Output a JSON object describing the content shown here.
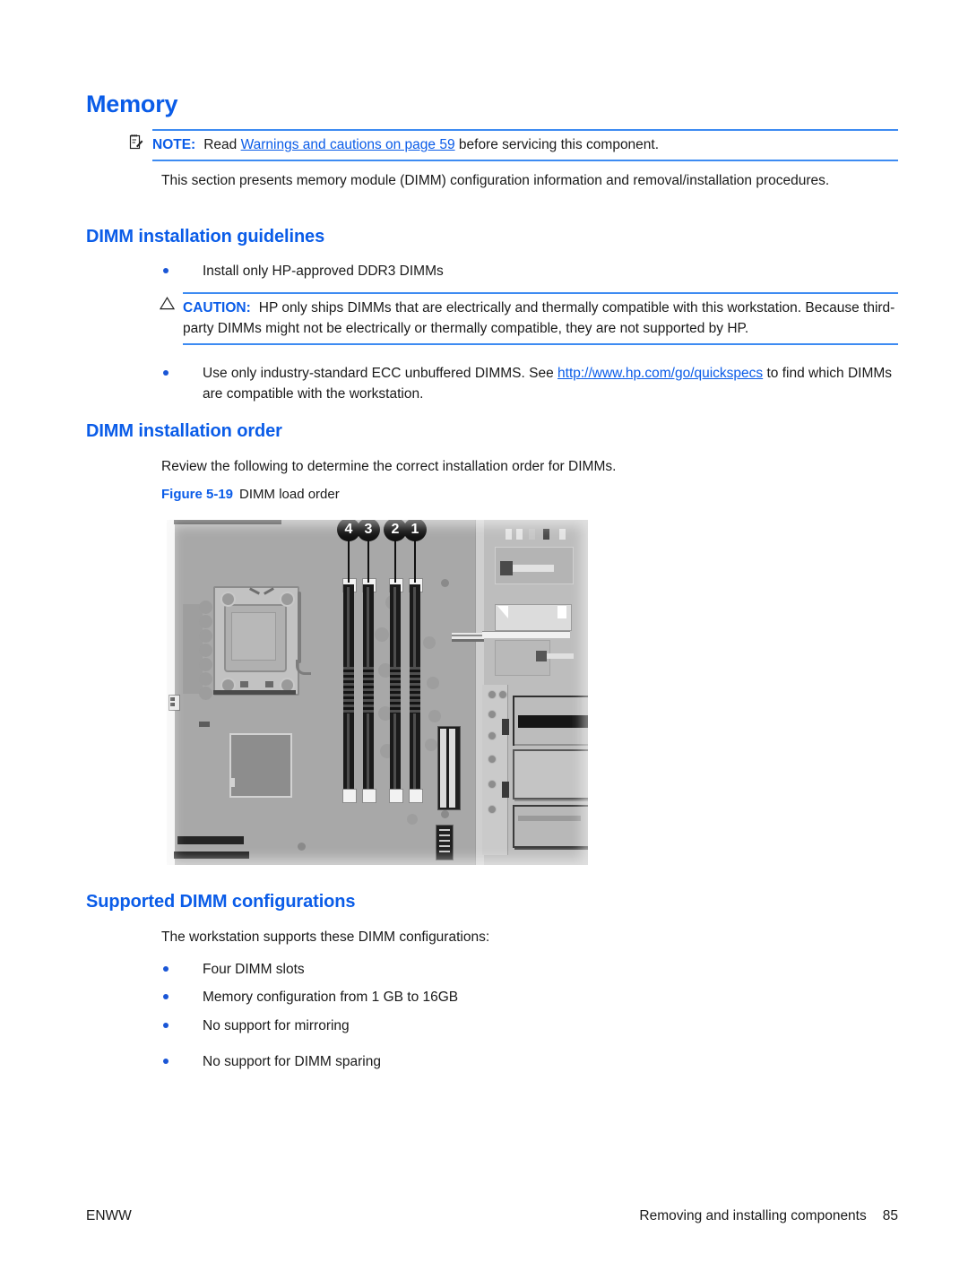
{
  "document": {
    "section_title": "Memory",
    "intro_paragraph": "This section presents memory module (DIMM) configuration information and removal/installation procedures."
  },
  "note": {
    "icon": "note-pad-icon",
    "label": "NOTE:",
    "text_before_link": "Read",
    "link_text": "Warnings and cautions on page 59",
    "text_after_link": "before servicing this component."
  },
  "guidelines": {
    "heading": "DIMM installation guidelines",
    "bullet_ddr3": "Install only HP-approved DDR3 DIMMs",
    "caution": {
      "icon": "warning-triangle-icon",
      "label": "CAUTION:",
      "text": "HP only ships DIMMs that are electrically and thermally compatible with this workstation. Because third-party DIMMs might not be electrically or thermally compatible, they are not supported by HP."
    },
    "bullet_ecc_before": "Use only industry-standard ECC unbuffered DIMMS. See",
    "bullet_ecc_link": "http://www.hp.com/go/quickspecs",
    "bullet_ecc_after": "to find which DIMMs are compatible with the workstation."
  },
  "order": {
    "heading": "DIMM installation order",
    "paragraph": "Review the following to determine the correct installation order for DIMMs.",
    "figure_number": "Figure 5-19",
    "figure_title": "DIMM load order",
    "figure_alt": "Workstation system board photo showing four DIMM slots numbered 4, 3, 2, 1 from left to right, CPU socket at left and expansion card area at right",
    "callouts": [
      {
        "number": "4"
      },
      {
        "number": "3"
      },
      {
        "number": "2"
      },
      {
        "number": "1"
      }
    ]
  },
  "supported": {
    "heading": "Supported DIMM configurations",
    "paragraph": "The workstation supports these DIMM configurations:",
    "bullets": [
      "Four DIMM slots",
      "Memory configuration from 1 GB to 16GB",
      "No support for mirroring",
      "No support for DIMM sparing"
    ]
  },
  "footer": {
    "left": "ENWW",
    "right": "Removing and installing components",
    "page_number": "85"
  },
  "colors": {
    "heading_blue": "#0a5ce8",
    "rule_blue": "#3d8bf2",
    "bullet_blue": "#1a56d6",
    "body_black": "#1a1a1a",
    "page_background": "#ffffff"
  }
}
